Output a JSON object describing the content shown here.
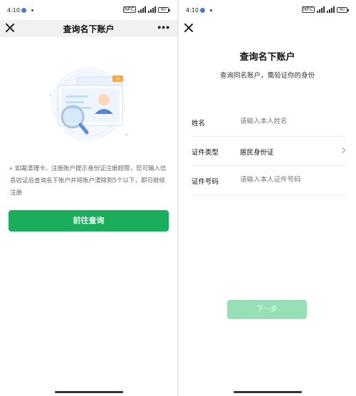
{
  "left": {
    "status": {
      "time": "4:10",
      "battery": "60",
      "nfc": "NFC"
    },
    "nav": {
      "title": "查询名下账户",
      "more": "•••"
    },
    "notice": "如需清理卡、注册账户提示身份证注册超限，您可输入信息验证后查询名下账户并将账户清除到5个以下，即可继续注册",
    "button": "前往查询"
  },
  "right": {
    "status": {
      "time": "4:10",
      "battery": "60",
      "nfc": "NFC"
    },
    "title": "查询名下账户",
    "subtitle": "查询同名账户，需验证你的身份",
    "form": {
      "name_label": "姓名",
      "name_placeholder": "请输入本人姓名",
      "idtype_label": "证件类型",
      "idtype_value": "居民身份证",
      "idnum_label": "证件号码",
      "idnum_placeholder": "请输入本人证件号码"
    },
    "next_button": "下一步"
  },
  "colors": {
    "primary": "#1aad5c",
    "disabled": "#97dfb4"
  },
  "icons": [
    "close-icon",
    "more-icon",
    "chevron-right-icon",
    "id-card-search-illustration"
  ]
}
